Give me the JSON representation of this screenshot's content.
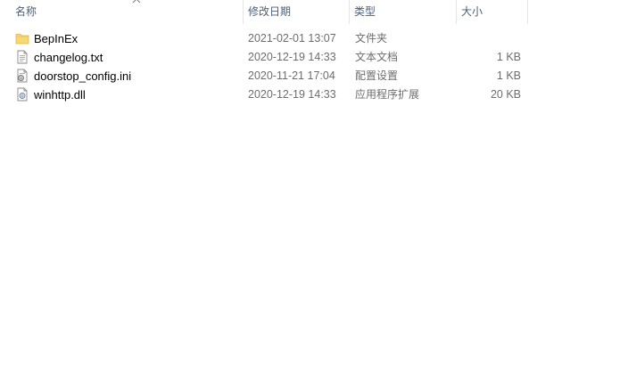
{
  "columns": {
    "name": "名称",
    "date": "修改日期",
    "type": "类型",
    "size": "大小"
  },
  "files": [
    {
      "name": "BepInEx",
      "date": "2021-02-01 13:07",
      "type": "文件夹",
      "size": "",
      "icon": "folder-icon"
    },
    {
      "name": "changelog.txt",
      "date": "2020-12-19 14:33",
      "type": "文本文档",
      "size": "1 KB",
      "icon": "text-file-icon"
    },
    {
      "name": "doorstop_config.ini",
      "date": "2020-11-21 17:04",
      "type": "配置设置",
      "size": "1 KB",
      "icon": "config-file-icon"
    },
    {
      "name": "winhttp.dll",
      "date": "2020-12-19 14:33",
      "type": "应用程序扩展",
      "size": "20 KB",
      "icon": "dll-file-icon"
    }
  ],
  "colors": {
    "header_text": "#4c607a",
    "folder": "#f8d775",
    "detail_text": "#6d6d6d"
  }
}
